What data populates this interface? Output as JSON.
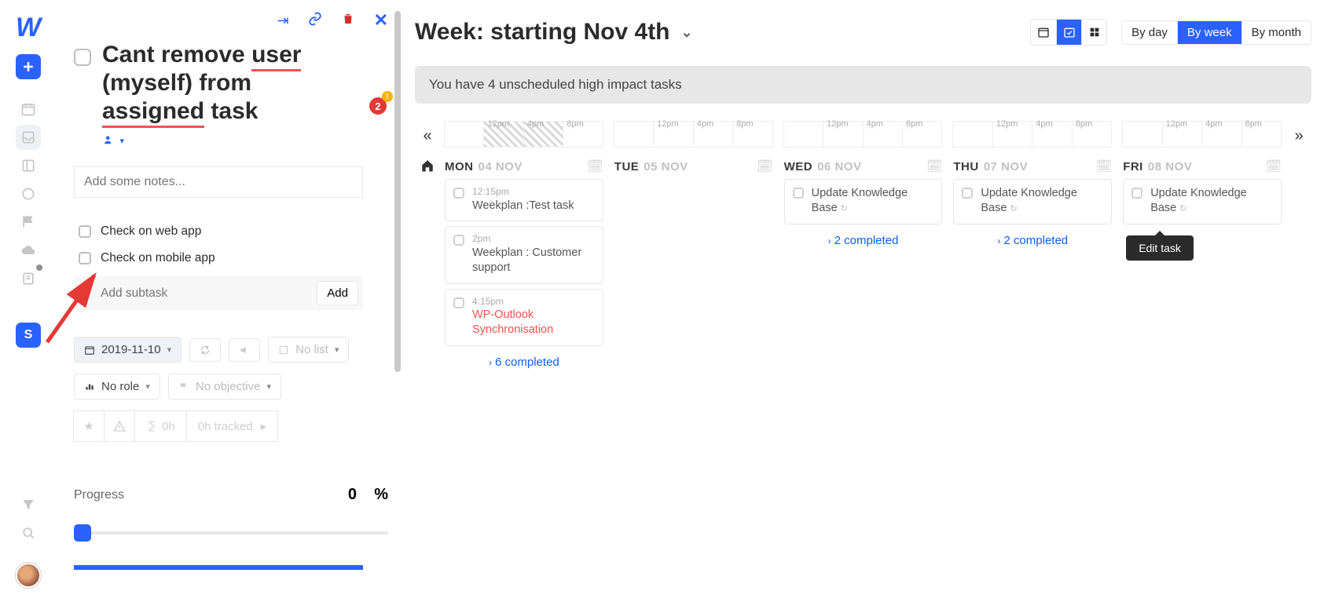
{
  "task_panel": {
    "title_full": "Cant remove user (myself) from assigned task",
    "title_seg_a": "Cant remove ",
    "title_seg_b": "user",
    "title_seg_c": " (myself) from ",
    "title_seg_d": "assigned",
    "title_seg_e": " task",
    "comments_count": "2",
    "notes_placeholder": "Add some notes...",
    "subtasks": [
      {
        "label": "Check on web app"
      },
      {
        "label": "Check on mobile app"
      }
    ],
    "add_subtask_placeholder": "Add subtask",
    "add_button": "Add",
    "date": "2019-11-10",
    "no_list": "No list",
    "no_role": "No role",
    "no_objective": "No objective",
    "estimate": "0h",
    "tracked": "0h tracked",
    "progress_label": "Progress",
    "progress_value": "0",
    "progress_pct": "%"
  },
  "main": {
    "title": "Week: starting Nov 4th",
    "range_views": [
      "By day",
      "By week",
      "By month"
    ],
    "active_range_view": "By week",
    "banner": "You have 4 unscheduled high impact tasks",
    "time_labels": [
      "12pm",
      "4pm",
      "8pm"
    ],
    "days": [
      {
        "dow": "MON",
        "date": "04 NOV"
      },
      {
        "dow": "TUE",
        "date": "05 NOV"
      },
      {
        "dow": "WED",
        "date": "06 NOV"
      },
      {
        "dow": "THU",
        "date": "07 NOV"
      },
      {
        "dow": "FRI",
        "date": "08 NOV"
      }
    ],
    "mon_cards": [
      {
        "time": "12:15pm",
        "title": "Weekplan :Test task",
        "red": false
      },
      {
        "time": "2pm",
        "title": "Weekplan : Customer support",
        "red": false
      },
      {
        "time": "4:15pm",
        "title": "WP-Outlook Synchronisation",
        "red": true
      }
    ],
    "mon_completed": "6 completed",
    "wed_card": {
      "title": "Update Knowledge Base",
      "recur": true
    },
    "wed_completed": "2 completed",
    "thu_card": {
      "title": "Update Knowledge Base",
      "recur": true
    },
    "thu_completed": "2 completed",
    "fri_card": {
      "title": "Update Knowledge Base",
      "recur": true
    },
    "tooltip": "Edit task"
  },
  "rail": {
    "workspace_letter": "S"
  }
}
